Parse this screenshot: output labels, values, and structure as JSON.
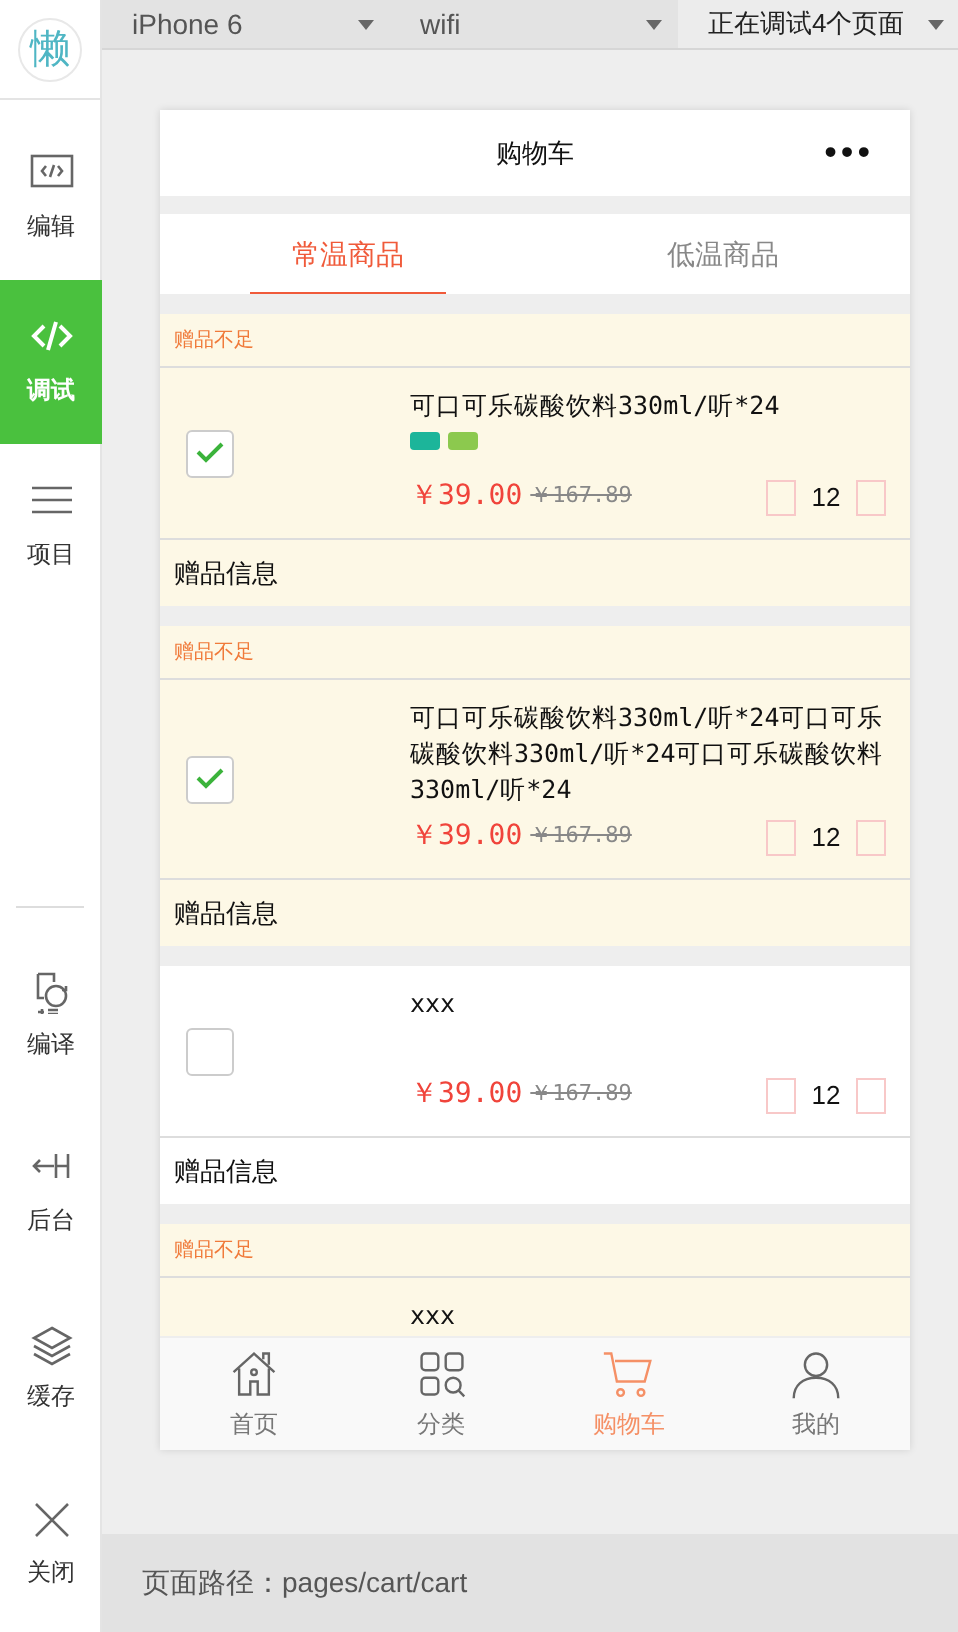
{
  "sidebar": {
    "logo": "懒",
    "top_items": [
      {
        "label": "编辑",
        "selected": false
      },
      {
        "label": "调试",
        "selected": true
      },
      {
        "label": "项目",
        "selected": false
      }
    ],
    "bottom_items": [
      {
        "label": "编译",
        "selected": false
      },
      {
        "label": "后台",
        "selected": false
      },
      {
        "label": "缓存",
        "selected": false
      },
      {
        "label": "关闭",
        "selected": false
      }
    ]
  },
  "toolbar": {
    "device": "iPhone 6",
    "network": "wifi",
    "debug_pages": "正在调试4个页面"
  },
  "phone": {
    "title": "购物车",
    "more": "•••",
    "tabs": [
      {
        "label": "常温商品",
        "selected": true
      },
      {
        "label": "低温商品",
        "selected": false
      }
    ],
    "items": [
      {
        "highlighted": true,
        "warning": "赠品不足",
        "checked": true,
        "name": "可口可乐碳酸饮料330ml/听*24",
        "tags": [
          {
            "color": "#1cb59a"
          },
          {
            "color": "#8cc94e"
          }
        ],
        "price": "￥39.00",
        "original_price": "￥167.89",
        "quantity": "12",
        "gift_label": "赠品信息"
      },
      {
        "highlighted": true,
        "warning": "赠品不足",
        "checked": true,
        "name": "可口可乐碳酸饮料330ml/听*24可口可乐碳酸饮料330ml/听*24可口可乐碳酸饮料330ml/听*24",
        "price": "￥39.00",
        "original_price": "￥167.89",
        "quantity": "12",
        "gift_label": "赠品信息"
      },
      {
        "highlighted": false,
        "checked": false,
        "name": "xxx",
        "price": "￥39.00",
        "original_price": "￥167.89",
        "quantity": "12",
        "gift_label": "赠品信息"
      },
      {
        "highlighted": true,
        "warning": "赠品不足",
        "name": "xxx"
      }
    ],
    "tabbar": [
      {
        "label": "首页",
        "selected": false
      },
      {
        "label": "分类",
        "selected": false
      },
      {
        "label": "购物车",
        "selected": true
      },
      {
        "label": "我的",
        "selected": false
      }
    ]
  },
  "status_bar": {
    "path": "页面路径：pages/cart/cart"
  }
}
